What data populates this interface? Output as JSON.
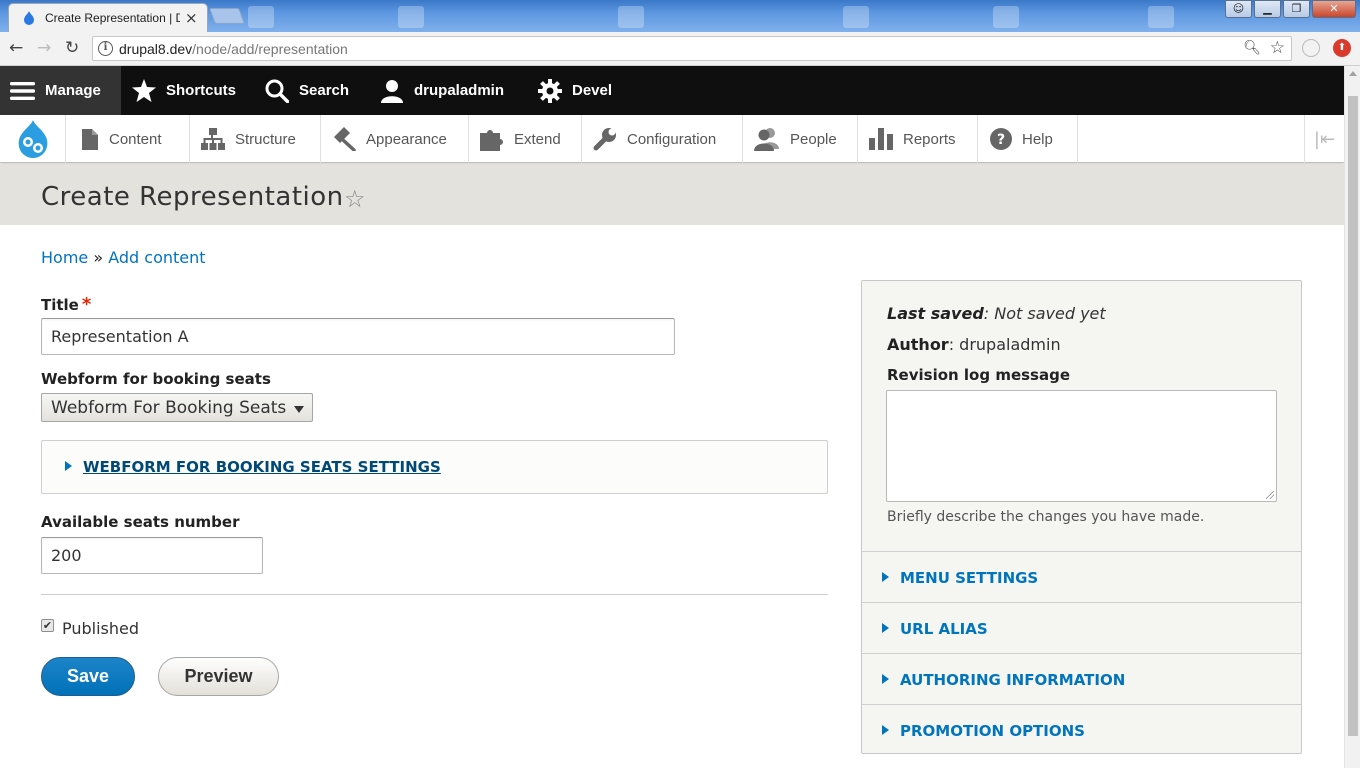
{
  "browser": {
    "tab_title": "Create Representation | D",
    "tab_close": "×",
    "url_host": "drupal8.dev",
    "url_path": "/node/add/representation"
  },
  "toolbar": {
    "manage": "Manage",
    "shortcuts": "Shortcuts",
    "search": "Search",
    "user": "drupaladmin",
    "devel": "Devel"
  },
  "tray": {
    "items": [
      {
        "label": "Content",
        "icon": "file-icon"
      },
      {
        "label": "Structure",
        "icon": "sitemap-icon"
      },
      {
        "label": "Appearance",
        "icon": "paintbrush-icon"
      },
      {
        "label": "Extend",
        "icon": "puzzle-icon"
      },
      {
        "label": "Configuration",
        "icon": "wrench-icon"
      },
      {
        "label": "People",
        "icon": "people-icon"
      },
      {
        "label": "Reports",
        "icon": "bar-chart-icon"
      },
      {
        "label": "Help",
        "icon": "help-icon"
      }
    ]
  },
  "page": {
    "title": "Create Representation",
    "breadcrumb": {
      "home": "Home",
      "sep": " » ",
      "add_content": "Add content"
    }
  },
  "form": {
    "title_label": "Title",
    "title_required": "*",
    "title_value": "Representation A",
    "webform_label": "Webform for booking seats",
    "webform_selected": "Webform For Booking Seats",
    "webform_settings": "WEBFORM FOR BOOKING SEATS SETTINGS",
    "seats_label": "Available seats number",
    "seats_value": "200",
    "published_label": "Published",
    "published_checked": true,
    "save": "Save",
    "preview": "Preview"
  },
  "sidebar": {
    "last_saved_label": "Last saved",
    "last_saved_value": ": Not saved yet",
    "author_label": "Author",
    "author_value": ": drupaladmin",
    "revision_label": "Revision log message",
    "revision_desc": "Briefly describe the changes you have made.",
    "sections": [
      "MENU SETTINGS",
      "URL ALIAS",
      "AUTHORING INFORMATION",
      "PROMOTION OPTIONS"
    ]
  },
  "colors": {
    "accent": "#0074bd",
    "toolbar_bg": "#0f0f0f",
    "header_bg": "#e3e2dd",
    "required": "#e62600"
  }
}
